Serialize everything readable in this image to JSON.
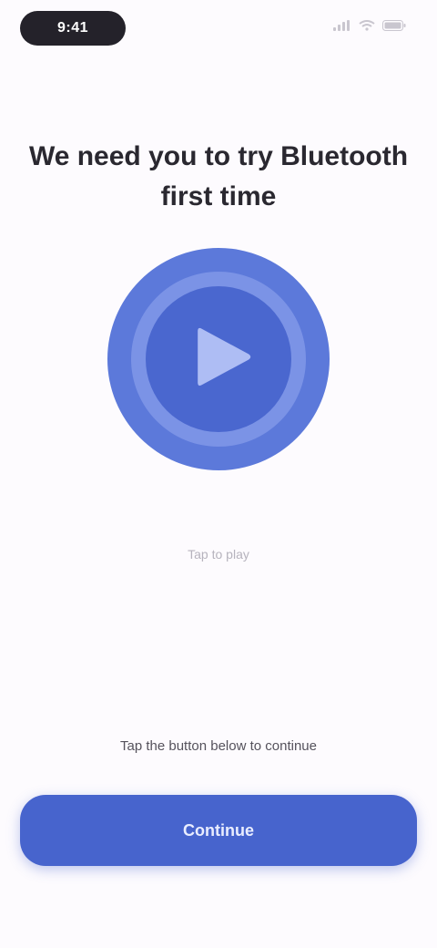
{
  "status_bar": {
    "time": "9:41",
    "icons": [
      "signal-icon",
      "wifi-icon",
      "battery-icon"
    ]
  },
  "title": "We need you to try Bluetooth first time",
  "play": {
    "icon": "play-icon",
    "color_outer": "#5c79da",
    "color_inner": "#4a67cf"
  },
  "hint": "Tap to play",
  "footer_note": "Tap the button below to continue",
  "primary_button": {
    "label": "Continue"
  }
}
